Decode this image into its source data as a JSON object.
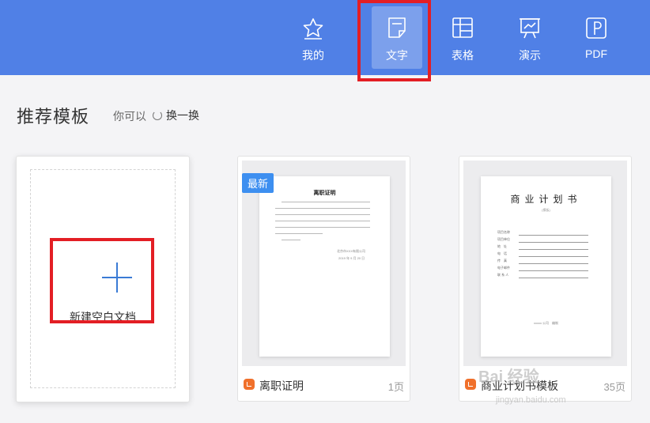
{
  "topbar": {
    "tabs": [
      {
        "label": "我的",
        "icon": "star-icon"
      },
      {
        "label": "文字",
        "icon": "document-icon",
        "active": true
      },
      {
        "label": "表格",
        "icon": "table-icon"
      },
      {
        "label": "演示",
        "icon": "presentation-icon"
      },
      {
        "label": "PDF",
        "icon": "pdf-icon"
      }
    ],
    "accent": "#5080e6"
  },
  "section": {
    "title": "推荐模板",
    "hint": "你可以",
    "refresh_label": "换一换"
  },
  "blank_card": {
    "label": "新建空白文档"
  },
  "templates": [
    {
      "badge": "最新",
      "name": "离职证明",
      "pages": "1页",
      "doc_title": "离职证明",
      "company": "北京市XXX有限公司",
      "date": "2019 年 9 月 20 日"
    },
    {
      "name": "商业计划书模板",
      "pages": "35页",
      "doc_title": "商业计划书",
      "doc_subtitle": "(模板)",
      "fields": [
        "项目名称",
        "项目单位",
        "地　址",
        "电　话",
        "传　真",
        "电子邮件",
        "联 系 人"
      ],
      "footer": "xxxxx 公司　编制"
    }
  ],
  "watermark": {
    "brand": "Bai 经验",
    "url": "jingyan.baidu.com"
  }
}
